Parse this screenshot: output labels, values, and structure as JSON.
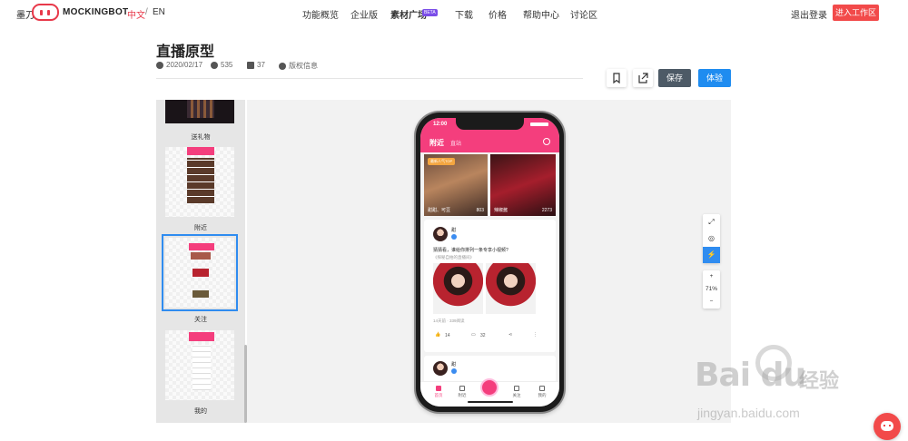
{
  "nav": {
    "brand_cn": "墨刀",
    "brand_en": "MOCKINGBOT",
    "lang_zh": "中文",
    "lang_sep": "/",
    "lang_en": "EN",
    "items": [
      "功能概览",
      "企业版",
      "素材广场",
      "下载",
      "价格",
      "帮助中心",
      "讨论区"
    ],
    "beta": "BETA",
    "logout": "退出登录",
    "enter": "进入工作区"
  },
  "project": {
    "title": "直播原型",
    "date": "2020/02/17",
    "views": "535",
    "count": "37",
    "copyright": "版权信息",
    "save": "保存",
    "try": "体验"
  },
  "sidebar": {
    "pages": [
      {
        "label": "送礼物"
      },
      {
        "label": "附近"
      },
      {
        "label": "关注"
      },
      {
        "label": "我的"
      }
    ],
    "selected": "关注"
  },
  "phone": {
    "time": "12:00",
    "tab_active": "附近",
    "tab_inactive": "直站",
    "top_tag": "最新人气TOP",
    "live1_name": "甜甜、可豆",
    "live1_num": "803",
    "live2_name": "辣椒酱",
    "live2_num": "2273",
    "post_user": "甜",
    "post_text": "猜猜看，谁给你排列一条专享小视频?",
    "post_sub": "《探秘自拍的直播间》",
    "post_time": "14天前 · 339阅读",
    "likes": "14",
    "comments": "32",
    "second_user": "甜",
    "bottom_nav": [
      "首页",
      "附近",
      "关注",
      "我的"
    ]
  },
  "zoom": {
    "fit_icon": "⤢",
    "plus": "+",
    "level": "71%",
    "minus": "−"
  },
  "watermark": {
    "brand": "Bai  du",
    "cn": "经验",
    "url": "jingyan.baidu.com"
  },
  "colors": {
    "accent": "#f24a4a",
    "phone_pink": "#f43e7d",
    "primary_blue": "#1f8cf0",
    "save_dark": "#4d5a66"
  }
}
